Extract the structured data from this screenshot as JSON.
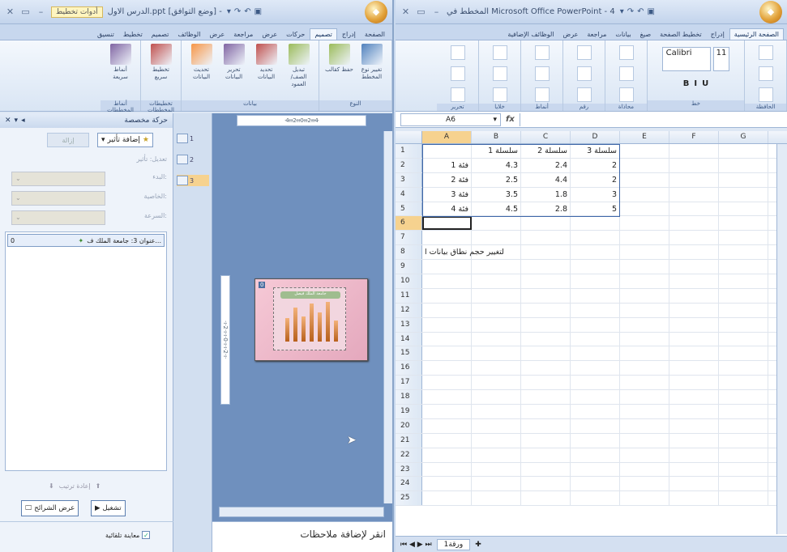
{
  "ppt": {
    "title_doc": "الدرس الاول.ppt [وضع التوافق] -",
    "title_tools": "أدوات تخطيط",
    "tabs": [
      "الصفحة",
      "إدراج",
      "تصميم",
      "حركات",
      "عرض",
      "مراجعة",
      "عرض",
      "الوظائف",
      "تصميم",
      "تخطيط",
      "تنسيق"
    ],
    "active_tab": "تصميم",
    "groups": [
      {
        "label": "النوع",
        "buttons": [
          "تغيير نوع المخطط",
          "حفظ كقالب"
        ]
      },
      {
        "label": "بيانات",
        "buttons": [
          "تبديل الصف/العمود",
          "تحديد البيانات",
          "تحرير البيانات",
          "تحديث البيانات"
        ]
      },
      {
        "label": "تخطيطات المخططات",
        "buttons": [
          "تخطيط سريع"
        ]
      },
      {
        "label": "أنماط المخططات",
        "buttons": [
          "أنماط سريعة"
        ]
      }
    ],
    "pane": {
      "title": "حركة مخصصة",
      "add_effect": "إضافة تأثير",
      "remove": "إزالة",
      "modify": "تعديل: تأثير",
      "start": "البدء:",
      "property": "الخاصية:",
      "speed": "السرعة:",
      "anim_item": "عنوان 3: جامعة الملك ف...",
      "anim_num": "0",
      "reorder": "إعادة ترتيب",
      "play": "تشغيل",
      "slideshow": "عرض الشرائح",
      "autopreview": "معاينة تلقائية"
    },
    "thumb_nums": [
      "1",
      "2",
      "3"
    ],
    "ruler_h": "·4·ı·ı·2·ı·ı·0·ı·ı·2·ı·ı·4·",
    "ruler_v": "·ı·2·ı·ı·0·ı·ı·2·ı·",
    "slide_num": "0",
    "slide_title": "جامعة الملك فيصل",
    "slide_bars": [
      0.55,
      0.8,
      0.6,
      0.9,
      0.7,
      0.95,
      0.5
    ],
    "notes_placeholder": "انقر لإضافة ملاحظات"
  },
  "excel": {
    "title": "المخطط في Microsoft Office PowerPoint - 4",
    "tabs": [
      "الصفحة الرئيسية",
      "إدراج",
      "تخطيط الصفحة",
      "صيغ",
      "بيانات",
      "مراجعة",
      "عرض",
      "الوظائف الإضافية"
    ],
    "active_tab": "الصفحة الرئيسية",
    "groups": [
      "الحافظة",
      "خط",
      "محاذاة",
      "رقم",
      "أنماط",
      "خلايا",
      "تحرير"
    ],
    "font_name": "Calibri",
    "font_size": "11",
    "namebox": "A6",
    "fx": "fx",
    "columns": [
      "A",
      "B",
      "C",
      "D",
      "E",
      "F",
      "G"
    ],
    "rows": [
      [
        "",
        "سلسلة 1",
        "سلسلة 2",
        "سلسلة 3",
        "",
        "",
        ""
      ],
      [
        "فئة 1",
        "4.3",
        "2.4",
        "2",
        "",
        "",
        ""
      ],
      [
        "فئة 2",
        "2.5",
        "4.4",
        "2",
        "",
        "",
        ""
      ],
      [
        "فئة 3",
        "3.5",
        "1.8",
        "3",
        "",
        "",
        ""
      ],
      [
        "فئة 4",
        "4.5",
        "2.8",
        "5",
        "",
        "",
        ""
      ],
      [
        "",
        "",
        "",
        "",
        "",
        "",
        ""
      ],
      [
        "",
        "",
        "",
        "",
        "",
        "",
        ""
      ],
      [
        "لتغيير حجم نطاق بيانات ا",
        "",
        "",
        "",
        "",
        "",
        ""
      ],
      [
        "",
        "",
        "",
        "",
        "",
        "",
        ""
      ],
      [
        "",
        "",
        "",
        "",
        "",
        "",
        ""
      ],
      [
        "",
        "",
        "",
        "",
        "",
        "",
        ""
      ],
      [
        "",
        "",
        "",
        "",
        "",
        "",
        ""
      ],
      [
        "",
        "",
        "",
        "",
        "",
        "",
        ""
      ],
      [
        "",
        "",
        "",
        "",
        "",
        "",
        ""
      ],
      [
        "",
        "",
        "",
        "",
        "",
        "",
        ""
      ],
      [
        "",
        "",
        "",
        "",
        "",
        "",
        ""
      ],
      [
        "",
        "",
        "",
        "",
        "",
        "",
        ""
      ],
      [
        "",
        "",
        "",
        "",
        "",
        "",
        ""
      ],
      [
        "",
        "",
        "",
        "",
        "",
        "",
        ""
      ],
      [
        "",
        "",
        "",
        "",
        "",
        "",
        ""
      ],
      [
        "",
        "",
        "",
        "",
        "",
        "",
        ""
      ],
      [
        "",
        "",
        "",
        "",
        "",
        "",
        ""
      ],
      [
        "",
        "",
        "",
        "",
        "",
        "",
        ""
      ],
      [
        "",
        "",
        "",
        "",
        "",
        "",
        ""
      ],
      [
        "",
        "",
        "",
        "",
        "",
        "",
        ""
      ]
    ],
    "sheet_tab": "ورقة1",
    "colors": {
      "selection": "#f6d28f",
      "range": "#3e67a8"
    }
  }
}
